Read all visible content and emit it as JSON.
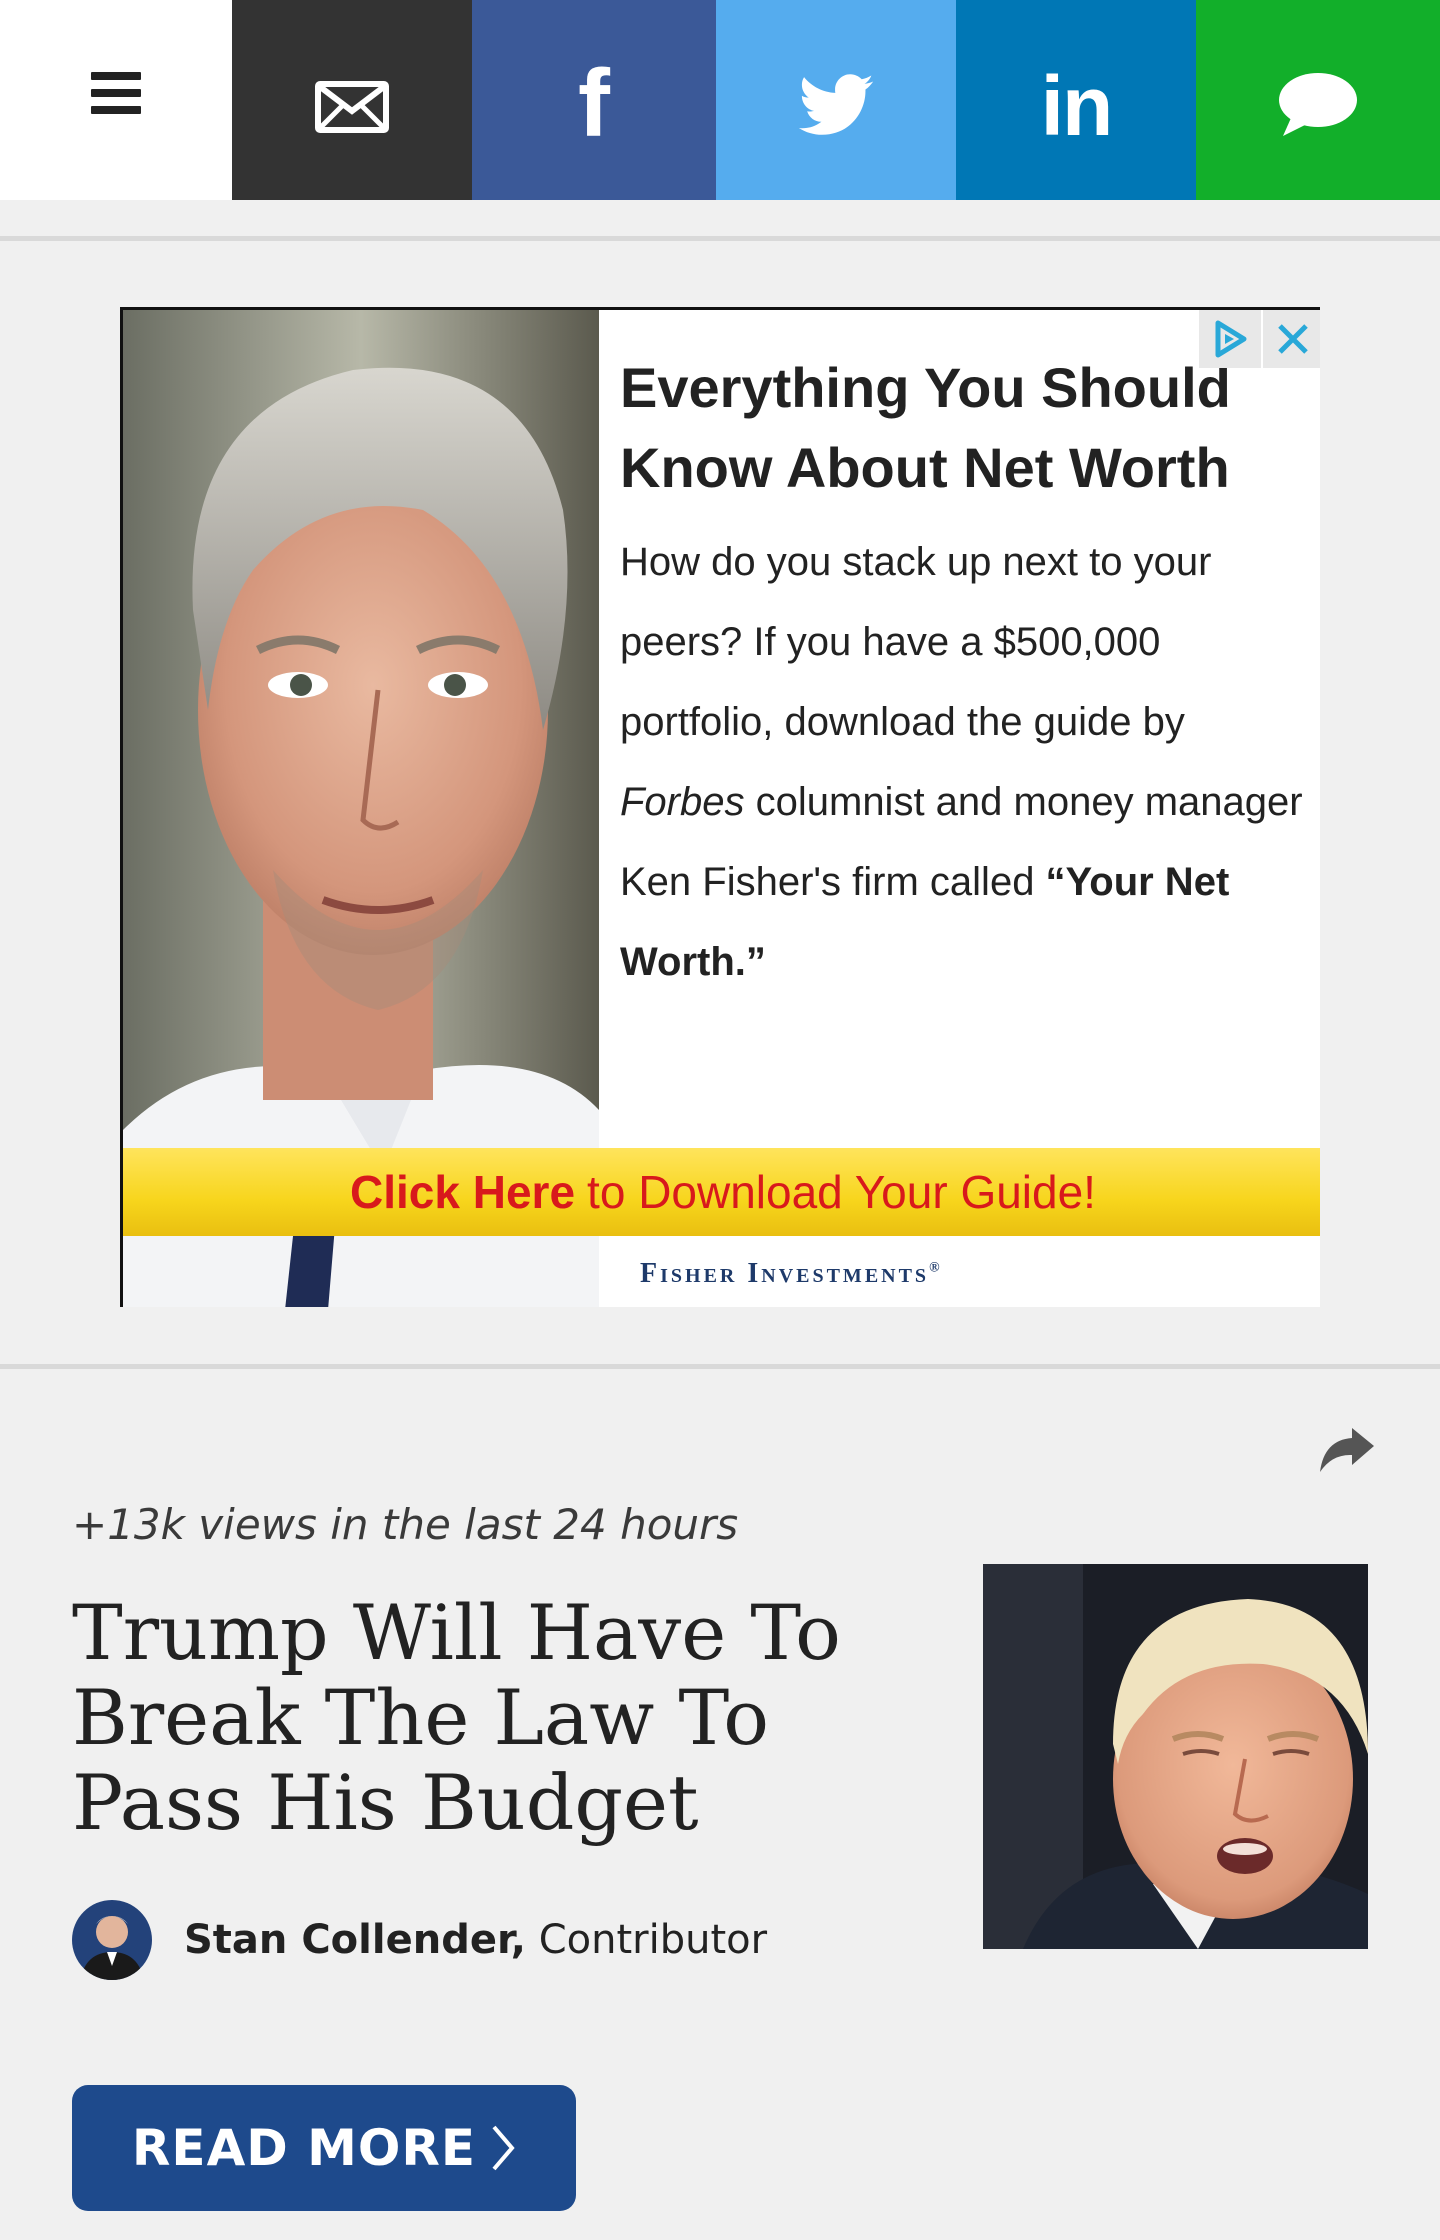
{
  "topbar": {
    "menu_icon": "hamburger-menu-icon",
    "share_buttons": [
      {
        "name": "email",
        "icon": "envelope-icon",
        "color": "#333333"
      },
      {
        "name": "facebook",
        "icon": "facebook-icon",
        "glyph": "f",
        "color": "#3b5998"
      },
      {
        "name": "twitter",
        "icon": "twitter-bird-icon",
        "color": "#55acee"
      },
      {
        "name": "linkedin",
        "icon": "linkedin-icon",
        "glyph": "in",
        "color": "#0077b5"
      },
      {
        "name": "sms",
        "icon": "speech-bubble-icon",
        "color": "#12af2a"
      }
    ]
  },
  "ad": {
    "headline": "Everything You Should Know About Net Worth",
    "body_part1": "How do you stack up next to your peers? If you have a $500,000 portfolio, download the guide by ",
    "body_brand": "Forbes",
    "body_part2": " columnist and money manager Ken Fisher's firm called ",
    "body_quote": "“Your Net Worth.”",
    "cta_bold": "Click Here",
    "cta_rest": "to Download Your Guide!",
    "footer": "Fisher Investments",
    "footer_mark": "®",
    "adchoices_icon": "adchoices-icon",
    "close_icon": "close-icon"
  },
  "article": {
    "views": "+13k views in the last 24 hours",
    "title": "Trump Will Have To Break The Law To Pass His Budget",
    "author_name": "Stan Collender,",
    "author_role": "Contributor",
    "read_more": "READ MORE",
    "share_icon": "share-arrow-icon"
  }
}
